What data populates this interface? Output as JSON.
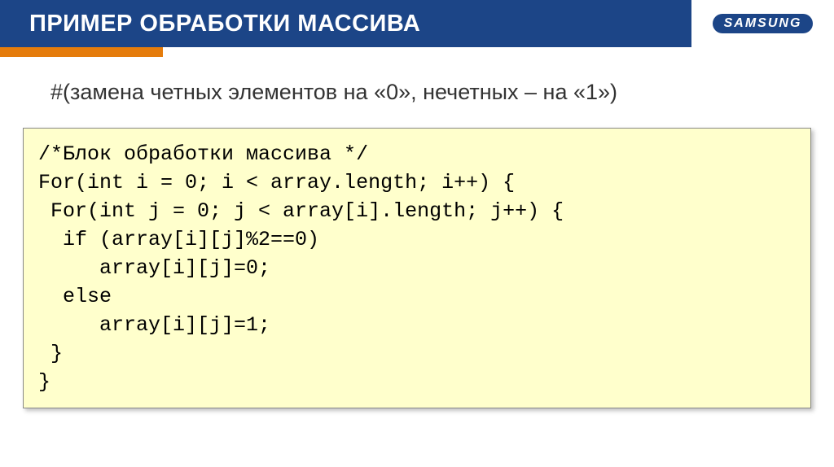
{
  "header": {
    "title": "ПРИМЕР ОБРАБОТКИ МАССИВА",
    "logo": "SAMSUNG"
  },
  "subtitle": "#(замена четных элементов на «0», нечетных – на «1»)",
  "code": {
    "line1": "/*Блок обработки массива */",
    "line2": "For(int i = 0; i < array.length; i++) {",
    "line3": " For(int j = 0; j < array[i].length; j++) {",
    "line4": "  if (array[i][j]%2==0)",
    "line5": "     array[i][j]=0;",
    "line6": "  else",
    "line7": "     array[i][j]=1;",
    "line8": " }",
    "line9": "}"
  }
}
